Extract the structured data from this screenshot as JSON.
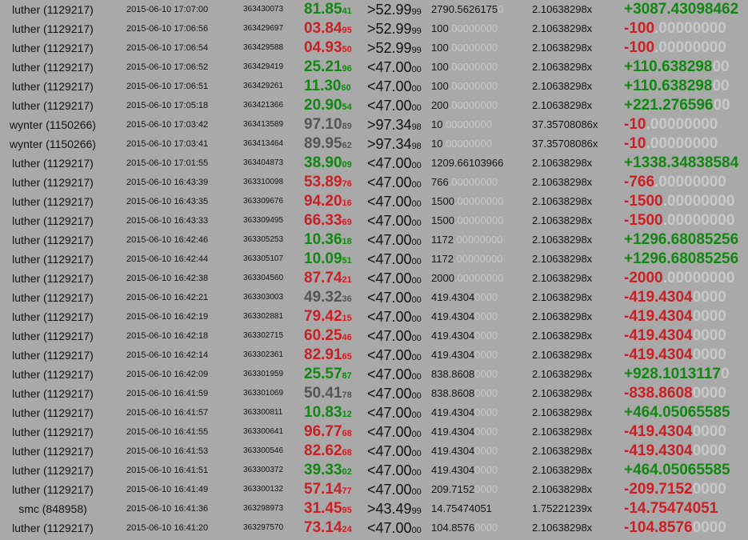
{
  "colors": {
    "background": "#a9a9a9",
    "win": "#118811",
    "lose": "#cc1f24",
    "neutral": "#555555",
    "dim_digits": "#c8c8c8"
  },
  "rows": [
    {
      "user": "luther (1129217)",
      "time": "2015-06-10 17:07:00",
      "bet_id": "363430073",
      "roll_main": "81.85",
      "roll_small": "41",
      "roll_class": "win",
      "target_main": ">52.99",
      "target_small": "99",
      "amount_main": "2790.5626175",
      "amount_dim": "0",
      "payout": "2.10638298x",
      "profit_main": "+3087.43098462",
      "profit_dim": "",
      "profit_class": "win"
    },
    {
      "user": "luther (1129217)",
      "time": "2015-06-10 17:06:56",
      "bet_id": "363429697",
      "roll_main": "03.84",
      "roll_small": "95",
      "roll_class": "lose",
      "target_main": ">52.99",
      "target_small": "99",
      "amount_main": "100",
      "amount_dim": ".00000000",
      "payout": "2.10638298x",
      "profit_main": "-100",
      "profit_dim": ".00000000",
      "profit_class": "lose"
    },
    {
      "user": "luther (1129217)",
      "time": "2015-06-10 17:06:54",
      "bet_id": "363429588",
      "roll_main": "04.93",
      "roll_small": "50",
      "roll_class": "lose",
      "target_main": ">52.99",
      "target_small": "99",
      "amount_main": "100",
      "amount_dim": ".00000000",
      "payout": "2.10638298x",
      "profit_main": "-100",
      "profit_dim": ".00000000",
      "profit_class": "lose"
    },
    {
      "user": "luther (1129217)",
      "time": "2015-06-10 17:06:52",
      "bet_id": "363429419",
      "roll_main": "25.21",
      "roll_small": "96",
      "roll_class": "win",
      "target_main": "<47.00",
      "target_small": "00",
      "amount_main": "100",
      "amount_dim": ".00000000",
      "payout": "2.10638298x",
      "profit_main": "+110.638298",
      "profit_dim": "00",
      "profit_class": "win"
    },
    {
      "user": "luther (1129217)",
      "time": "2015-06-10 17:06:51",
      "bet_id": "363429261",
      "roll_main": "11.30",
      "roll_small": "60",
      "roll_class": "win",
      "target_main": "<47.00",
      "target_small": "00",
      "amount_main": "100",
      "amount_dim": ".00000000",
      "payout": "2.10638298x",
      "profit_main": "+110.638298",
      "profit_dim": "00",
      "profit_class": "win"
    },
    {
      "user": "luther (1129217)",
      "time": "2015-06-10 17:05:18",
      "bet_id": "363421366",
      "roll_main": "20.90",
      "roll_small": "54",
      "roll_class": "win",
      "target_main": "<47.00",
      "target_small": "00",
      "amount_main": "200",
      "amount_dim": ".00000000",
      "payout": "2.10638298x",
      "profit_main": "+221.276596",
      "profit_dim": "00",
      "profit_class": "win"
    },
    {
      "user": "wynter (1150266)",
      "time": "2015-06-10 17:03:42",
      "bet_id": "363413589",
      "roll_main": "97.10",
      "roll_small": "89",
      "roll_class": "neutral",
      "target_main": ">97.34",
      "target_small": "98",
      "amount_main": "10",
      "amount_dim": ".00000000",
      "payout": "37.35708086x",
      "profit_main": "-10",
      "profit_dim": ".00000000",
      "profit_class": "lose"
    },
    {
      "user": "wynter (1150266)",
      "time": "2015-06-10 17:03:41",
      "bet_id": "363413464",
      "roll_main": "89.95",
      "roll_small": "62",
      "roll_class": "neutral",
      "target_main": ">97.34",
      "target_small": "98",
      "amount_main": "10",
      "amount_dim": ".00000000",
      "payout": "37.35708086x",
      "profit_main": "-10",
      "profit_dim": ".00000000",
      "profit_class": "lose"
    },
    {
      "user": "luther (1129217)",
      "time": "2015-06-10 17:01:55",
      "bet_id": "363404873",
      "roll_main": "38.90",
      "roll_small": "09",
      "roll_class": "win",
      "target_main": "<47.00",
      "target_small": "00",
      "amount_main": "1209.66103966",
      "amount_dim": "",
      "payout": "2.10638298x",
      "profit_main": "+1338.34838584",
      "profit_dim": "",
      "profit_class": "win"
    },
    {
      "user": "luther (1129217)",
      "time": "2015-06-10 16:43:39",
      "bet_id": "363310098",
      "roll_main": "53.89",
      "roll_small": "76",
      "roll_class": "lose",
      "target_main": "<47.00",
      "target_small": "00",
      "amount_main": "766",
      "amount_dim": ".00000000",
      "payout": "2.10638298x",
      "profit_main": "-766",
      "profit_dim": ".00000000",
      "profit_class": "lose"
    },
    {
      "user": "luther (1129217)",
      "time": "2015-06-10 16:43:35",
      "bet_id": "363309676",
      "roll_main": "94.20",
      "roll_small": "16",
      "roll_class": "lose",
      "target_main": "<47.00",
      "target_small": "00",
      "amount_main": "1500",
      "amount_dim": ".00000000",
      "payout": "2.10638298x",
      "profit_main": "-1500",
      "profit_dim": ".00000000",
      "profit_class": "lose"
    },
    {
      "user": "luther (1129217)",
      "time": "2015-06-10 16:43:33",
      "bet_id": "363309495",
      "roll_main": "66.33",
      "roll_small": "69",
      "roll_class": "lose",
      "target_main": "<47.00",
      "target_small": "00",
      "amount_main": "1500",
      "amount_dim": ".00000000",
      "payout": "2.10638298x",
      "profit_main": "-1500",
      "profit_dim": ".00000000",
      "profit_class": "lose"
    },
    {
      "user": "luther (1129217)",
      "time": "2015-06-10 16:42:46",
      "bet_id": "363305253",
      "roll_main": "10.36",
      "roll_small": "18",
      "roll_class": "win",
      "target_main": "<47.00",
      "target_small": "00",
      "amount_main": "1172",
      "amount_dim": ".00000000",
      "payout": "2.10638298x",
      "profit_main": "+1296.68085256",
      "profit_dim": "",
      "profit_class": "win"
    },
    {
      "user": "luther (1129217)",
      "time": "2015-06-10 16:42:44",
      "bet_id": "363305107",
      "roll_main": "10.09",
      "roll_small": "51",
      "roll_class": "win",
      "target_main": "<47.00",
      "target_small": "00",
      "amount_main": "1172",
      "amount_dim": ".00000000",
      "payout": "2.10638298x",
      "profit_main": "+1296.68085256",
      "profit_dim": "",
      "profit_class": "win"
    },
    {
      "user": "luther (1129217)",
      "time": "2015-06-10 16:42:38",
      "bet_id": "363304560",
      "roll_main": "87.74",
      "roll_small": "21",
      "roll_class": "lose",
      "target_main": "<47.00",
      "target_small": "00",
      "amount_main": "2000",
      "amount_dim": ".00000000",
      "payout": "2.10638298x",
      "profit_main": "-2000",
      "profit_dim": ".00000000",
      "profit_class": "lose"
    },
    {
      "user": "luther (1129217)",
      "time": "2015-06-10 16:42:21",
      "bet_id": "363303003",
      "roll_main": "49.32",
      "roll_small": "36",
      "roll_class": "neutral",
      "target_main": "<47.00",
      "target_small": "00",
      "amount_main": "419.4304",
      "amount_dim": "0000",
      "payout": "2.10638298x",
      "profit_main": "-419.4304",
      "profit_dim": "0000",
      "profit_class": "lose"
    },
    {
      "user": "luther (1129217)",
      "time": "2015-06-10 16:42:19",
      "bet_id": "363302881",
      "roll_main": "79.42",
      "roll_small": "15",
      "roll_class": "lose",
      "target_main": "<47.00",
      "target_small": "00",
      "amount_main": "419.4304",
      "amount_dim": "0000",
      "payout": "2.10638298x",
      "profit_main": "-419.4304",
      "profit_dim": "0000",
      "profit_class": "lose"
    },
    {
      "user": "luther (1129217)",
      "time": "2015-06-10 16:42:18",
      "bet_id": "363302715",
      "roll_main": "60.25",
      "roll_small": "46",
      "roll_class": "lose",
      "target_main": "<47.00",
      "target_small": "00",
      "amount_main": "419.4304",
      "amount_dim": "0000",
      "payout": "2.10638298x",
      "profit_main": "-419.4304",
      "profit_dim": "0000",
      "profit_class": "lose"
    },
    {
      "user": "luther (1129217)",
      "time": "2015-06-10 16:42:14",
      "bet_id": "363302361",
      "roll_main": "82.91",
      "roll_small": "65",
      "roll_class": "lose",
      "target_main": "<47.00",
      "target_small": "00",
      "amount_main": "419.4304",
      "amount_dim": "0000",
      "payout": "2.10638298x",
      "profit_main": "-419.4304",
      "profit_dim": "0000",
      "profit_class": "lose"
    },
    {
      "user": "luther (1129217)",
      "time": "2015-06-10 16:42:09",
      "bet_id": "363301959",
      "roll_main": "25.57",
      "roll_small": "87",
      "roll_class": "win",
      "target_main": "<47.00",
      "target_small": "00",
      "amount_main": "838.8608",
      "amount_dim": "0000",
      "payout": "2.10638298x",
      "profit_main": "+928.1013117",
      "profit_dim": "0",
      "profit_class": "win"
    },
    {
      "user": "luther (1129217)",
      "time": "2015-06-10 16:41:59",
      "bet_id": "363301069",
      "roll_main": "50.41",
      "roll_small": "78",
      "roll_class": "neutral",
      "target_main": "<47.00",
      "target_small": "00",
      "amount_main": "838.8608",
      "amount_dim": "0000",
      "payout": "2.10638298x",
      "profit_main": "-838.8608",
      "profit_dim": "0000",
      "profit_class": "lose"
    },
    {
      "user": "luther (1129217)",
      "time": "2015-06-10 16:41:57",
      "bet_id": "363300811",
      "roll_main": "10.83",
      "roll_small": "12",
      "roll_class": "win",
      "target_main": "<47.00",
      "target_small": "00",
      "amount_main": "419.4304",
      "amount_dim": "0000",
      "payout": "2.10638298x",
      "profit_main": "+464.05065585",
      "profit_dim": "",
      "profit_class": "win"
    },
    {
      "user": "luther (1129217)",
      "time": "2015-06-10 16:41:55",
      "bet_id": "363300641",
      "roll_main": "96.77",
      "roll_small": "68",
      "roll_class": "lose",
      "target_main": "<47.00",
      "target_small": "00",
      "amount_main": "419.4304",
      "amount_dim": "0000",
      "payout": "2.10638298x",
      "profit_main": "-419.4304",
      "profit_dim": "0000",
      "profit_class": "lose"
    },
    {
      "user": "luther (1129217)",
      "time": "2015-06-10 16:41:53",
      "bet_id": "363300546",
      "roll_main": "82.62",
      "roll_small": "68",
      "roll_class": "lose",
      "target_main": "<47.00",
      "target_small": "00",
      "amount_main": "419.4304",
      "amount_dim": "0000",
      "payout": "2.10638298x",
      "profit_main": "-419.4304",
      "profit_dim": "0000",
      "profit_class": "lose"
    },
    {
      "user": "luther (1129217)",
      "time": "2015-06-10 16:41:51",
      "bet_id": "363300372",
      "roll_main": "39.33",
      "roll_small": "02",
      "roll_class": "win",
      "target_main": "<47.00",
      "target_small": "00",
      "amount_main": "419.4304",
      "amount_dim": "0000",
      "payout": "2.10638298x",
      "profit_main": "+464.05065585",
      "profit_dim": "",
      "profit_class": "win"
    },
    {
      "user": "luther (1129217)",
      "time": "2015-06-10 16:41:49",
      "bet_id": "363300132",
      "roll_main": "57.14",
      "roll_small": "77",
      "roll_class": "lose",
      "target_main": "<47.00",
      "target_small": "00",
      "amount_main": "209.7152",
      "amount_dim": "0000",
      "payout": "2.10638298x",
      "profit_main": "-209.7152",
      "profit_dim": "0000",
      "profit_class": "lose"
    },
    {
      "user": "smc (848958)",
      "time": "2015-06-10 16:41:36",
      "bet_id": "363298973",
      "roll_main": "31.45",
      "roll_small": "95",
      "roll_class": "lose",
      "target_main": ">43.49",
      "target_small": "99",
      "amount_main": "14.75474051",
      "amount_dim": "",
      "payout": "1.75221239x",
      "profit_main": "-14.75474051",
      "profit_dim": "",
      "profit_class": "lose"
    },
    {
      "user": "luther (1129217)",
      "time": "2015-06-10 16:41:20",
      "bet_id": "363297570",
      "roll_main": "73.14",
      "roll_small": "24",
      "roll_class": "lose",
      "target_main": "<47.00",
      "target_small": "00",
      "amount_main": "104.8576",
      "amount_dim": "0000",
      "payout": "2.10638298x",
      "profit_main": "-104.8576",
      "profit_dim": "0000",
      "profit_class": "lose"
    }
  ]
}
